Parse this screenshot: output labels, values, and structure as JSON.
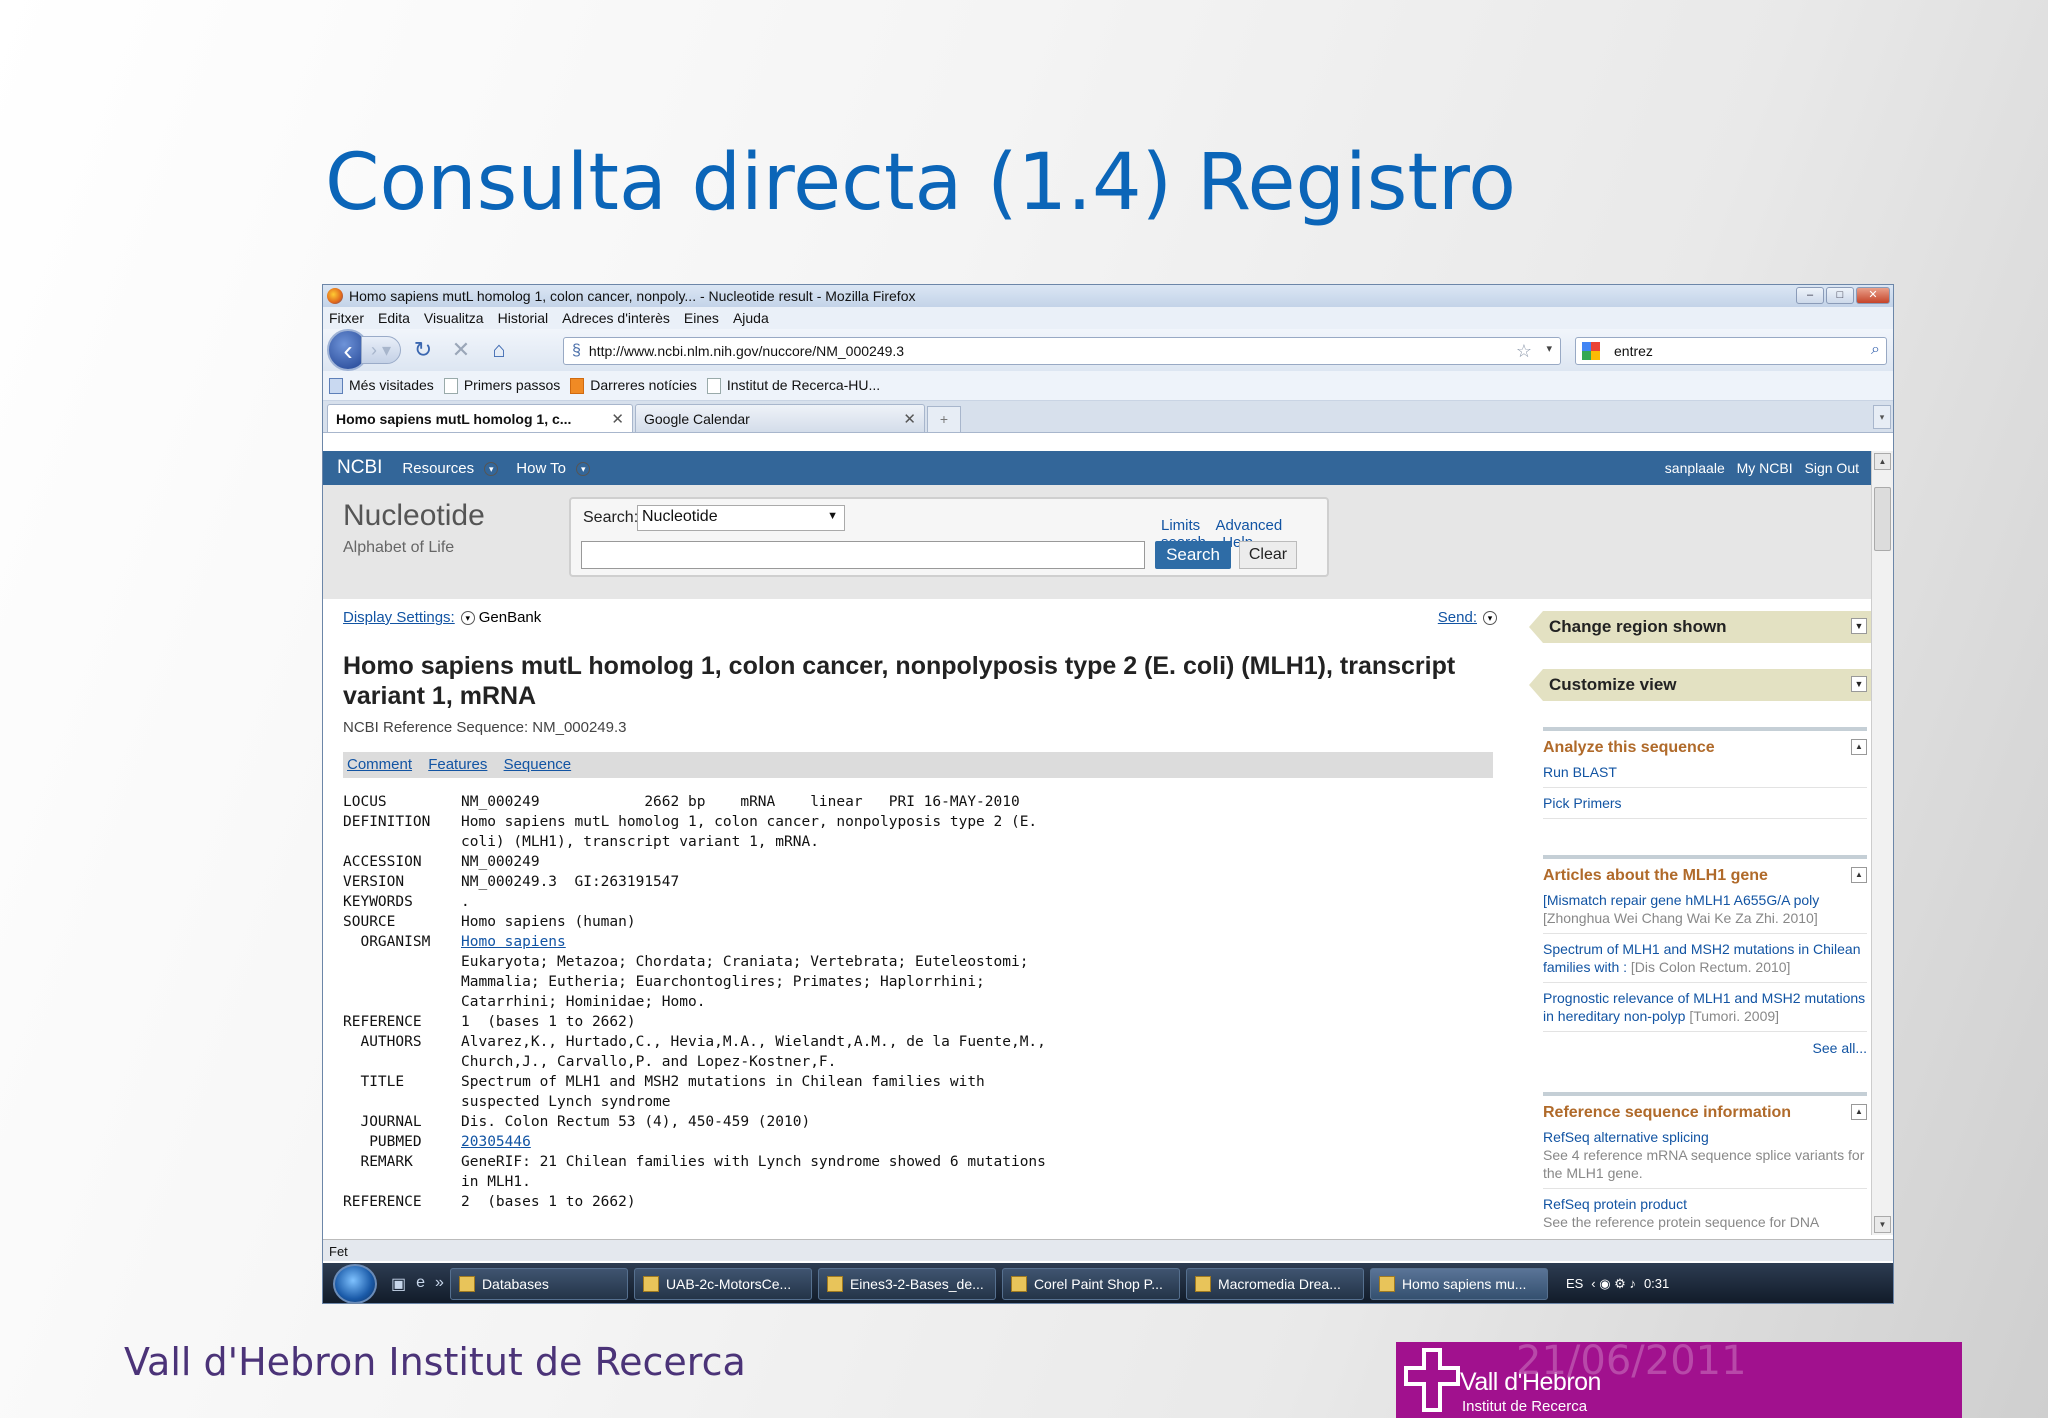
{
  "slide": {
    "title": "Consulta directa (1.4) Registro",
    "footer_institution": "Vall d'Hebron Institut de Recerca",
    "date": "21/06/2011",
    "logo_name": "Vall d'Hebron",
    "logo_sub": "Institut de Recerca"
  },
  "browser": {
    "window_title": "Homo sapiens mutL homolog 1, colon cancer, nonpoly... - Nucleotide result - Mozilla Firefox",
    "menu": [
      "Fitxer",
      "Edita",
      "Visualitza",
      "Historial",
      "Adreces d'interès",
      "Eines",
      "Ajuda"
    ],
    "url": "http://www.ncbi.nlm.nih.gov/nuccore/NM_000249.3",
    "search_query": "entrez",
    "bookmarks": [
      "Més visitades",
      "Primers passos",
      "Darreres notícies",
      "Institut de Recerca-HU..."
    ],
    "tabs": [
      {
        "label": "Homo sapiens mutL homolog 1, c...",
        "active": true
      },
      {
        "label": "Google Calendar",
        "active": false
      }
    ],
    "status": "Fet"
  },
  "ncbi": {
    "logo": "NCBI",
    "menu": [
      "Resources",
      "How To"
    ],
    "user": [
      "sanplaale",
      "My NCBI",
      "Sign Out"
    ],
    "db_title": "Nucleotide",
    "db_subtitle": "Alphabet of Life",
    "search_label": "Search:",
    "db_selected": "Nucleotide",
    "links": [
      "Limits",
      "Advanced search",
      "Help"
    ],
    "search_button": "Search",
    "clear_button": "Clear"
  },
  "record": {
    "display_settings": "Display Settings:",
    "format": "GenBank",
    "send": "Send:",
    "title": "Homo sapiens mutL homolog 1, colon cancer, nonpolyposis type 2 (E. coli) (MLH1), transcript variant 1, mRNA",
    "subtitle": "NCBI Reference Sequence: NM_000249.3",
    "anchors": [
      "Comment",
      "Features",
      "Sequence"
    ],
    "genbank": [
      {
        "k": "LOCUS",
        "v": "NM_000249            2662 bp    mRNA    linear   PRI 16-MAY-2010"
      },
      {
        "k": "DEFINITION",
        "v": "Homo sapiens mutL homolog 1, colon cancer, nonpolyposis type 2 (E."
      },
      {
        "k": "",
        "v": "coli) (MLH1), transcript variant 1, mRNA."
      },
      {
        "k": "ACCESSION",
        "v": "NM_000249"
      },
      {
        "k": "VERSION",
        "v": "NM_000249.3  GI:263191547"
      },
      {
        "k": "KEYWORDS",
        "v": "."
      },
      {
        "k": "SOURCE",
        "v": "Homo sapiens (human)"
      },
      {
        "k": "  ORGANISM",
        "v": "Homo sapiens",
        "link": true
      },
      {
        "k": "",
        "v": "Eukaryota; Metazoa; Chordata; Craniata; Vertebrata; Euteleostomi;"
      },
      {
        "k": "",
        "v": "Mammalia; Eutheria; Euarchontoglires; Primates; Haplorrhini;"
      },
      {
        "k": "",
        "v": "Catarrhini; Hominidae; Homo."
      },
      {
        "k": "REFERENCE",
        "v": "1  (bases 1 to 2662)"
      },
      {
        "k": "  AUTHORS",
        "v": "Alvarez,K., Hurtado,C., Hevia,M.A., Wielandt,A.M., de la Fuente,M.,"
      },
      {
        "k": "",
        "v": "Church,J., Carvallo,P. and Lopez-Kostner,F."
      },
      {
        "k": "  TITLE",
        "v": "Spectrum of MLH1 and MSH2 mutations in Chilean families with"
      },
      {
        "k": "",
        "v": "suspected Lynch syndrome"
      },
      {
        "k": "  JOURNAL",
        "v": "Dis. Colon Rectum 53 (4), 450-459 (2010)"
      },
      {
        "k": "   PUBMED",
        "v": "20305446",
        "link": true
      },
      {
        "k": "  REMARK",
        "v": "GeneRIF: 21 Chilean families with Lynch syndrome showed 6 mutations"
      },
      {
        "k": "",
        "v": "in MLH1."
      },
      {
        "k": "REFERENCE",
        "v": "2  (bases 1 to 2662)"
      }
    ]
  },
  "sidebar": {
    "change_region": "Change region shown",
    "customize": "Customize view",
    "analyze": {
      "title": "Analyze this sequence",
      "items": [
        "Run BLAST",
        "Pick Primers"
      ]
    },
    "articles": {
      "title": "Articles about the MLH1 gene",
      "items": [
        {
          "text": "[Mismatch repair gene hMLH1 A655G/A poly",
          "src": "[Zhonghua Wei Chang Wai Ke Za Zhi. 2010]"
        },
        {
          "text": "Spectrum of MLH1 and MSH2 mutations in Chilean families with :",
          "src": "[Dis Colon Rectum. 2010]"
        },
        {
          "text": "Prognostic relevance of MLH1 and MSH2 mutations in hereditary non-polyp",
          "src": "[Tumori. 2009]"
        }
      ],
      "more": "See all..."
    },
    "refseq": {
      "title": "Reference sequence information",
      "items": [
        {
          "text": "RefSeq alternative splicing",
          "desc": "See 4 reference mRNA sequence splice variants for the MLH1 gene."
        },
        {
          "text": "RefSeq protein product",
          "desc": "See the reference protein sequence for DNA"
        }
      ]
    }
  },
  "taskbar": {
    "items": [
      "Databases",
      "UAB-2c-MotorsCe...",
      "Eines3-2-Bases_de...",
      "Corel Paint Shop P...",
      "Macromedia Drea...",
      "Homo sapiens mu..."
    ],
    "lang": "ES",
    "time": "0:31"
  }
}
